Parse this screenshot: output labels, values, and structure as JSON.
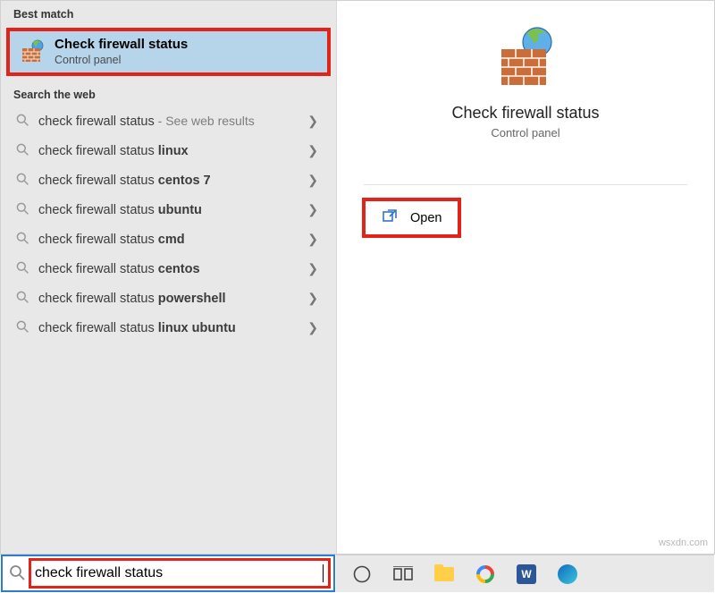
{
  "left": {
    "best_match_header": "Best match",
    "best_match": {
      "title": "Check firewall status",
      "subtitle": "Control panel"
    },
    "web_header": "Search the web",
    "web_results": [
      {
        "prefix": "check firewall status",
        "bold": "",
        "suffix": " - See web results"
      },
      {
        "prefix": "check firewall status ",
        "bold": "linux",
        "suffix": ""
      },
      {
        "prefix": "check firewall status ",
        "bold": "centos 7",
        "suffix": ""
      },
      {
        "prefix": "check firewall status ",
        "bold": "ubuntu",
        "suffix": ""
      },
      {
        "prefix": "check firewall status ",
        "bold": "cmd",
        "suffix": ""
      },
      {
        "prefix": "check firewall status ",
        "bold": "centos",
        "suffix": ""
      },
      {
        "prefix": "check firewall status ",
        "bold": "powershell",
        "suffix": ""
      },
      {
        "prefix": "check firewall status ",
        "bold": "linux ubuntu",
        "suffix": ""
      }
    ]
  },
  "right": {
    "title": "Check firewall status",
    "subtitle": "Control panel",
    "action_label": "Open"
  },
  "search": {
    "value": "check firewall status"
  },
  "taskbar": {
    "word_letter": "W"
  },
  "watermark": "wsxdn.com"
}
